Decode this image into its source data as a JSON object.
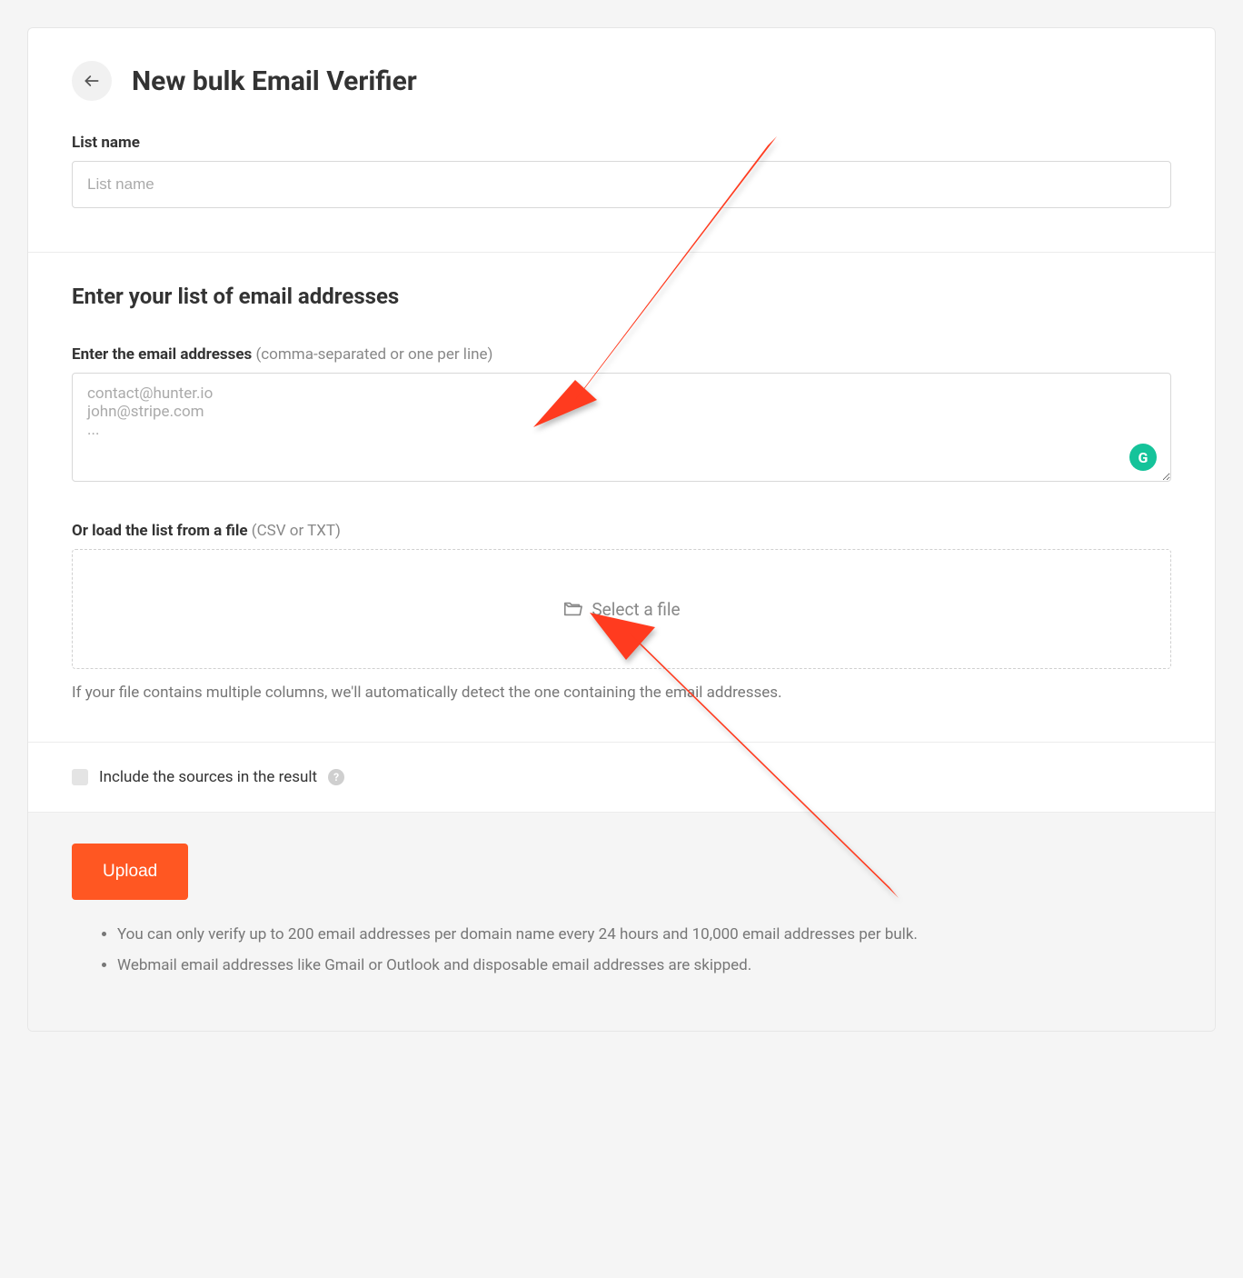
{
  "header": {
    "title": "New bulk Email Verifier"
  },
  "listName": {
    "label": "List name",
    "placeholder": "List name"
  },
  "emailSection": {
    "title": "Enter your list of email addresses",
    "enterLabel": "Enter the email addresses",
    "enterHint": " (comma-separated or one per line)",
    "placeholder": "contact@hunter.io\njohn@stripe.com\n...",
    "grammarlyGlyph": "G",
    "fileLabel": "Or load the list from a file",
    "fileHint": " (CSV or TXT)",
    "selectFile": "Select a file",
    "fileHelper": "If your file contains multiple columns, we'll automatically detect the one containing the email addresses."
  },
  "options": {
    "includeSources": "Include the sources in the result"
  },
  "footer": {
    "uploadLabel": "Upload",
    "note1": "You can only verify up to 200 email addresses per domain name every 24 hours and 10,000 email addresses per bulk.",
    "note2": "Webmail email addresses like Gmail or Outlook and disposable email addresses are skipped."
  }
}
